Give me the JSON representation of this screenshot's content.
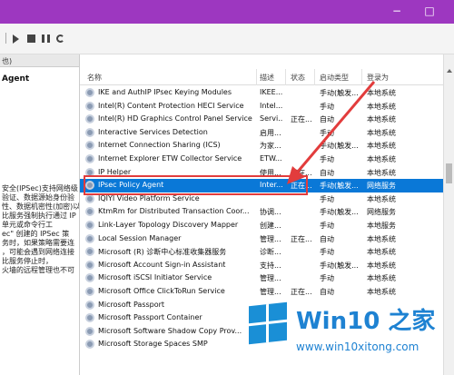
{
  "titlebar": {
    "color": "#9d37c0",
    "controls": [
      "−",
      "□"
    ]
  },
  "left_pane": {
    "header": "也)",
    "title": "Agent",
    "description": [
      "安全(IPSec)支持网络级",
      "验证、数据源始身份验",
      "性、数据机密性(加密)以",
      "比服务强制执行通过 IP",
      "单元或命令行工",
      "ec\" 创建的 IPSec 策",
      "务时，如果策略需要连",
      "，可能会遇到网络连接",
      "比服务停止时，",
      "火墙的远程管理也不可"
    ]
  },
  "columns": {
    "name": "名称",
    "desc": "描述",
    "status": "状态",
    "startup": "启动类型",
    "logon": "登录为"
  },
  "services": [
    {
      "name": "IKE and AuthIP IPsec Keying Modules",
      "desc": "IKEE...",
      "status": "",
      "startup": "手动(触发...",
      "logon": "本地系统"
    },
    {
      "name": "Intel(R) Content Protection HECI Service",
      "desc": "Intel...",
      "status": "",
      "startup": "手动",
      "logon": "本地系统"
    },
    {
      "name": "Intel(R) HD Graphics Control Panel Service",
      "desc": "Servi...",
      "status": "正在...",
      "startup": "自动",
      "logon": "本地系统"
    },
    {
      "name": "Interactive Services Detection",
      "desc": "启用...",
      "status": "",
      "startup": "手动",
      "logon": "本地系统"
    },
    {
      "name": "Internet Connection Sharing (ICS)",
      "desc": "为家...",
      "status": "",
      "startup": "手动(触发...",
      "logon": "本地系统"
    },
    {
      "name": "Internet Explorer ETW Collector Service",
      "desc": "ETW...",
      "status": "",
      "startup": "手动",
      "logon": "本地系统"
    },
    {
      "name": "IP Helper",
      "desc": "使用...",
      "status": "正在...",
      "startup": "自动",
      "logon": "本地系统"
    },
    {
      "name": "IPsec Policy Agent",
      "desc": "Inter...",
      "status": "正在...",
      "startup": "手动(触发...",
      "logon": "网络服务"
    },
    {
      "name": "IQIYI Video Platform Service",
      "desc": "",
      "status": "",
      "startup": "手动",
      "logon": "本地系统"
    },
    {
      "name": "KtmRm for Distributed Transaction Coor...",
      "desc": "协调...",
      "status": "",
      "startup": "手动(触发...",
      "logon": "网络服务"
    },
    {
      "name": "Link-Layer Topology Discovery Mapper",
      "desc": "创建...",
      "status": "",
      "startup": "手动",
      "logon": "本地服务"
    },
    {
      "name": "Local Session Manager",
      "desc": "管理...",
      "status": "正在...",
      "startup": "自动",
      "logon": "本地系统"
    },
    {
      "name": "Microsoft (R) 诊断中心标准收集器服务",
      "desc": "诊断...",
      "status": "",
      "startup": "手动",
      "logon": "本地系统"
    },
    {
      "name": "Microsoft Account Sign-in Assistant",
      "desc": "支持...",
      "status": "",
      "startup": "手动(触发...",
      "logon": "本地系统"
    },
    {
      "name": "Microsoft iSCSI Initiator Service",
      "desc": "管理...",
      "status": "",
      "startup": "手动",
      "logon": "本地系统"
    },
    {
      "name": "Microsoft Office ClickToRun Service",
      "desc": "管理...",
      "status": "正在...",
      "startup": "自动",
      "logon": "本地系统"
    },
    {
      "name": "Microsoft Passport",
      "desc": "",
      "status": "",
      "startup": "",
      "logon": ""
    },
    {
      "name": "Microsoft Passport Container",
      "desc": "",
      "status": "",
      "startup": "",
      "logon": ""
    },
    {
      "name": "Microsoft Software Shadow Copy Prov...",
      "desc": "",
      "status": "",
      "startup": "",
      "logon": ""
    },
    {
      "name": "Microsoft Storage Spaces SMP",
      "desc": "",
      "status": "",
      "startup": "",
      "logon": ""
    }
  ],
  "selected_index": 7,
  "watermark": {
    "title": "Win10 之家",
    "url": "www.win10xitong.com",
    "color": "#1e82d2"
  }
}
